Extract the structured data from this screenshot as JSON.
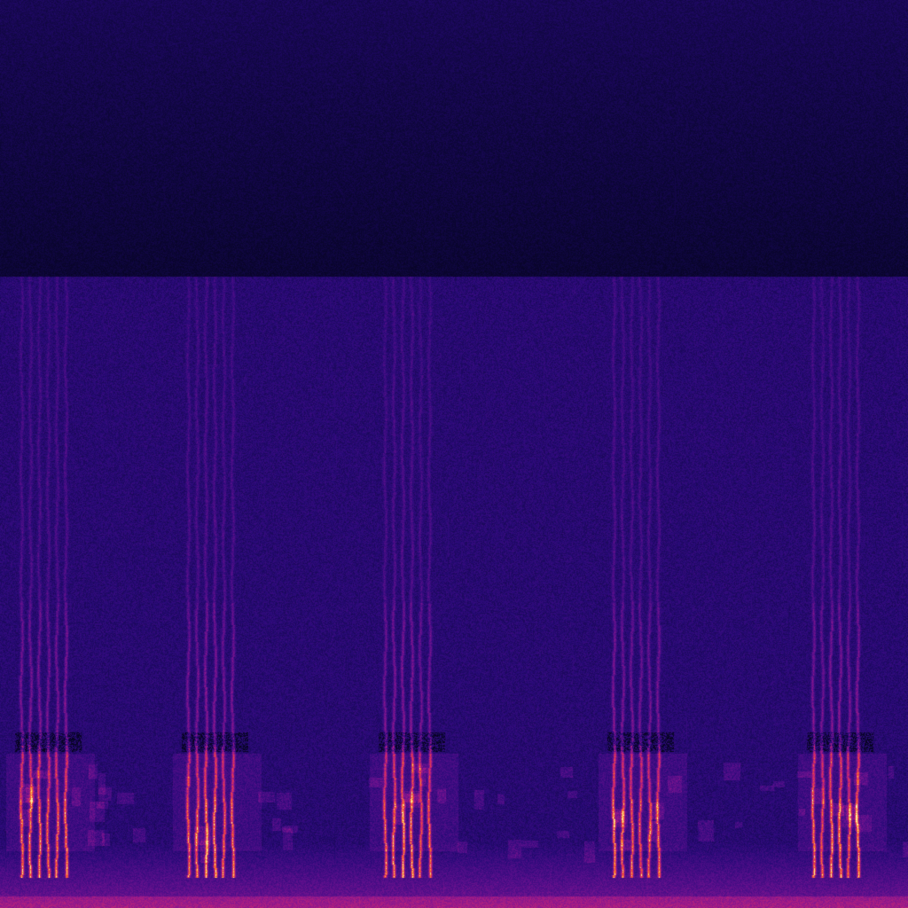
{
  "image": {
    "kind": "spectrogram",
    "colormap": "magma-like",
    "colors": {
      "upper_band_background": "#09053a",
      "lower_band_background": "#2a0a78",
      "bright_accent": "#ff3a1a",
      "mid_accent": "#b01a9a",
      "floor_glow": "#a0147a"
    },
    "call_bursts_count": 5
  }
}
